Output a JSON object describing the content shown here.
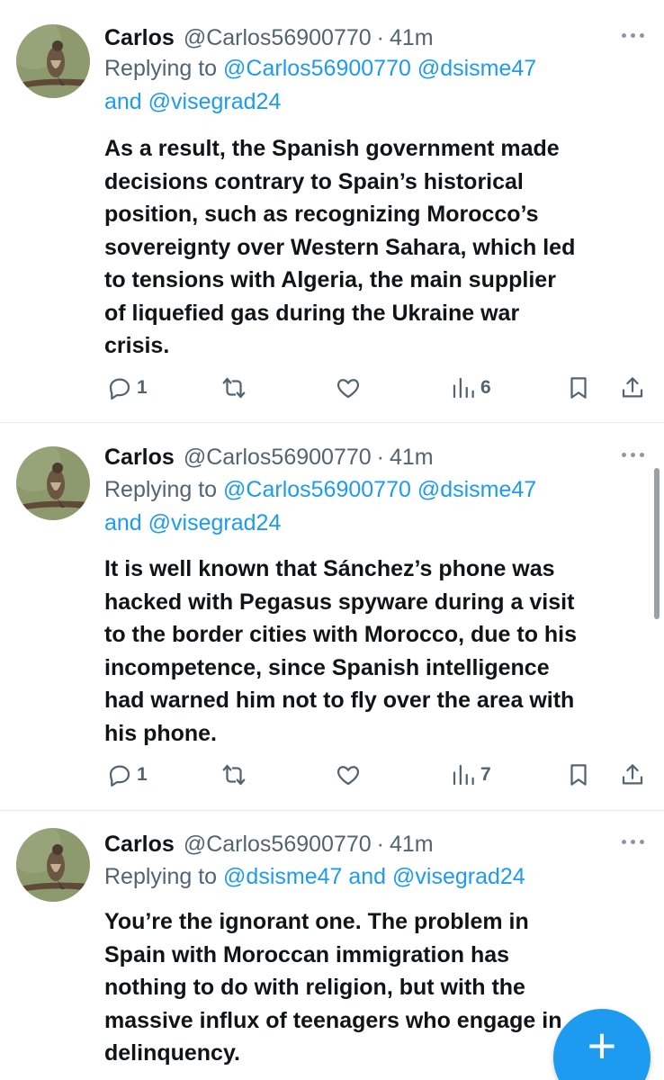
{
  "tweets": [
    {
      "name": "Carlos",
      "handle": "@Carlos56900770",
      "time": "41m",
      "replying_prefix": "Replying to ",
      "replying_line1_mentions": "@Carlos56900770 @dsisme47",
      "replying_line2_and": "and ",
      "replying_line2_mention": "@visegrad24",
      "lines": [
        "As a result, the Spanish government made",
        "decisions contrary to Spain’s historical",
        "position, such as recognizing Morocco’s",
        "sovereignty over Western Sahara, which led",
        "to tensions with Algeria, the main supplier",
        "of liquefied gas during the Ukraine war",
        "crisis."
      ],
      "replies": "1",
      "views": "6"
    },
    {
      "name": "Carlos",
      "handle": "@Carlos56900770",
      "time": "41m",
      "replying_prefix": "Replying to ",
      "replying_line1_mentions": "@Carlos56900770 @dsisme47",
      "replying_line2_and": "and ",
      "replying_line2_mention": "@visegrad24",
      "lines": [
        "It is well known that Sánchez’s phone was",
        "hacked with Pegasus spyware during a visit",
        "to the border cities with Morocco, due to his",
        "incompetence, since Spanish intelligence",
        "had warned him not to fly over the area with",
        "his phone."
      ],
      "replies": "1",
      "views": "7"
    },
    {
      "name": "Carlos",
      "handle": "@Carlos56900770",
      "time": "41m",
      "replying_prefix": "Replying to ",
      "replying_mention_a": "@dsisme47",
      "replying_and": " and ",
      "replying_mention_b": "@visegrad24",
      "lines": [
        "You’re the ignorant one. The problem in",
        "Spain with Moroccan immigration has",
        "nothing to do with religion, but with the",
        "massive influx of teenagers who engage in",
        "delinquency."
      ]
    }
  ],
  "separator": "·",
  "fab_label": "+",
  "colors": {
    "accent": "#1d9bf0",
    "text": "#0f1419",
    "secondary": "#536471",
    "divider": "#e6e9eb"
  },
  "icons": [
    "reply-icon",
    "retweet-icon",
    "like-icon",
    "views-icon",
    "bookmark-icon",
    "share-icon",
    "more-icon",
    "compose-icon"
  ]
}
